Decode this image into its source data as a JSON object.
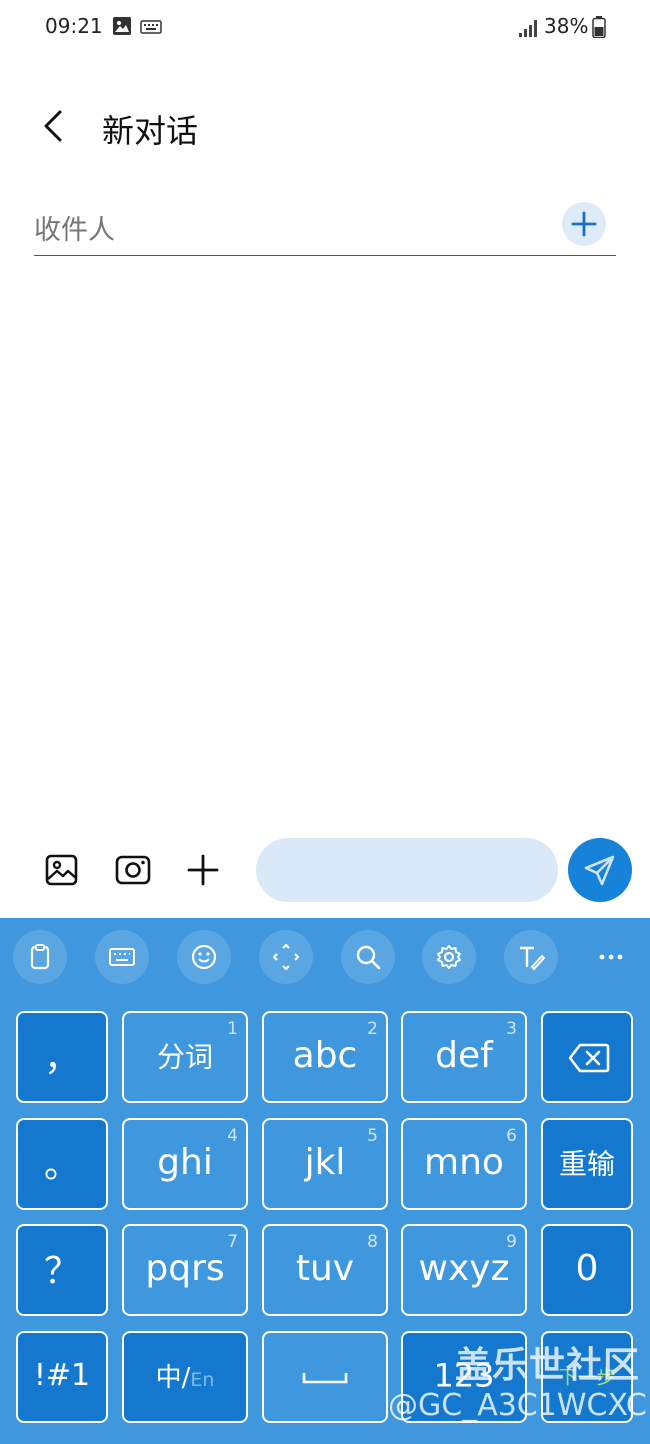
{
  "status_bar": {
    "time": "09:21",
    "battery": "38%",
    "icons": [
      "image-icon",
      "keyboard-icon",
      "signal-icon",
      "battery-icon"
    ]
  },
  "header": {
    "title": "新对话",
    "back_icon": "back-chevron-icon"
  },
  "recipient": {
    "placeholder": "收件人",
    "add_icon": "plus-icon"
  },
  "composer": {
    "icons": [
      "gallery-icon",
      "camera-icon",
      "plus-icon"
    ],
    "send_icon": "send-icon"
  },
  "keyboard": {
    "toolbar": [
      "clipboard-icon",
      "keyboard-icon",
      "emoji-icon",
      "cursor-move-icon",
      "search-icon",
      "settings-icon",
      "handwriting-icon",
      "more-icon"
    ],
    "rows": [
      [
        {
          "label": "，",
          "num": ""
        },
        {
          "label": "分词",
          "num": "1"
        },
        {
          "label": "abc",
          "num": "2"
        },
        {
          "label": "def",
          "num": "3"
        },
        {
          "label": "",
          "icon": "backspace-icon"
        }
      ],
      [
        {
          "label": "。",
          "num": ""
        },
        {
          "label": "ghi",
          "num": "4"
        },
        {
          "label": "jkl",
          "num": "5"
        },
        {
          "label": "mno",
          "num": "6"
        },
        {
          "label": "重输",
          "num": ""
        }
      ],
      [
        {
          "label": "？",
          "num": ""
        },
        {
          "label": "pqrs",
          "num": "7"
        },
        {
          "label": "tuv",
          "num": "8"
        },
        {
          "label": "wxyz",
          "num": "9"
        },
        {
          "label": "0",
          "num": ""
        }
      ],
      [
        {
          "label": "!#1",
          "num": ""
        },
        {
          "label": "中/",
          "sub": "En"
        },
        {
          "label": "",
          "icon": "space-icon"
        },
        {
          "label": "123",
          "num": ""
        },
        {
          "label": "下一步",
          "num": ""
        }
      ]
    ]
  },
  "watermark": {
    "line1": "盖乐世社区",
    "line2": "@GC_A3C1WCXC"
  },
  "colors": {
    "accent": "#1782d9",
    "keyboard_bg": "#3f97dd",
    "key_dark": "#1478cf",
    "input_bg": "#d9e9f8"
  }
}
